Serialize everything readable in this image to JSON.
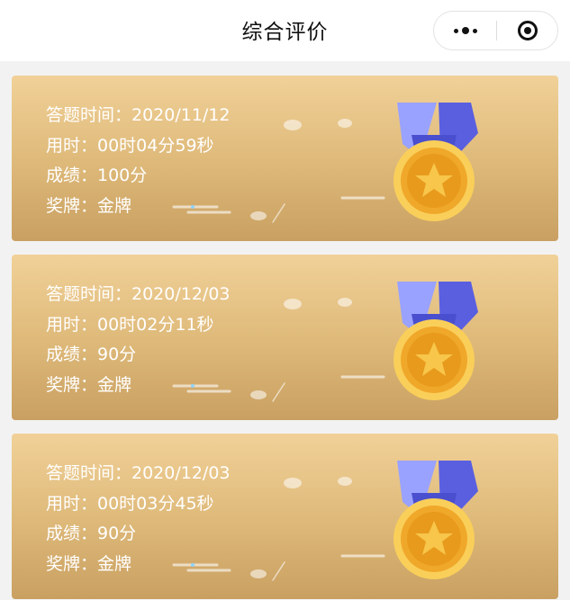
{
  "header": {
    "title": "综合评价"
  },
  "records": [
    {
      "time_line": "答题时间：2020/11/12",
      "duration_line": "用时：00时04分59秒",
      "score_line": "成绩：100分",
      "medal_line": "奖牌：金牌"
    },
    {
      "time_line": "答题时间：2020/12/03",
      "duration_line": "用时：00时02分11秒",
      "score_line": "成绩：90分",
      "medal_line": "奖牌：金牌"
    },
    {
      "time_line": "答题时间：2020/12/03",
      "duration_line": "用时：00时03分45秒",
      "score_line": "成绩：90分",
      "medal_line": "奖牌：金牌"
    }
  ],
  "colors": {
    "card_top": "#f1d198",
    "card_bottom": "#c9a062",
    "ribbon": "#5a5fe0",
    "medal_gold": "#f5b63a"
  },
  "icons": {
    "more": "more-dots-icon",
    "close": "target-close-icon",
    "medal": "gold-medal-icon"
  }
}
